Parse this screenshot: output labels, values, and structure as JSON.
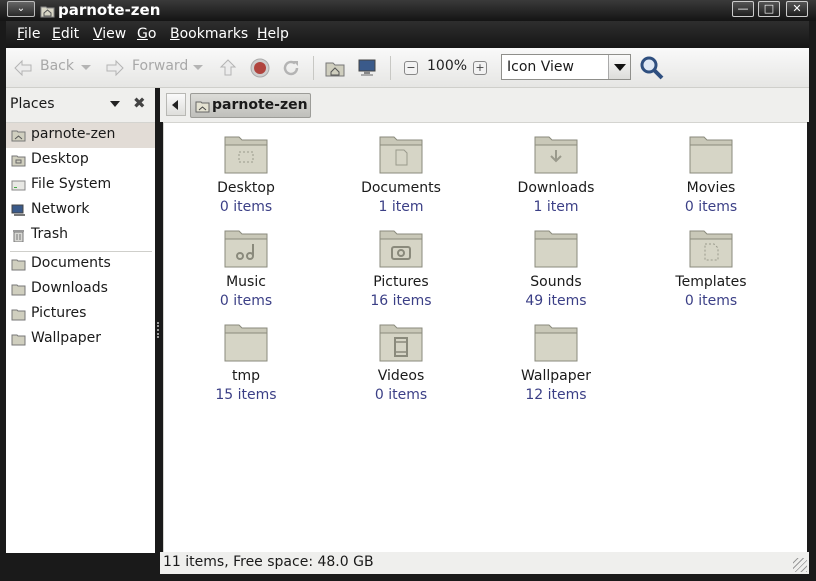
{
  "window": {
    "title": "parnote-zen",
    "controls": [
      "minimize",
      "maximize",
      "close"
    ]
  },
  "menubar": {
    "items": [
      "File",
      "Edit",
      "View",
      "Go",
      "Bookmarks",
      "Help"
    ]
  },
  "toolbar": {
    "back_label": "Back",
    "forward_label": "Forward",
    "zoom_level": "100%",
    "view_mode": "Icon View"
  },
  "sidebar": {
    "title": "Places",
    "items": [
      {
        "label": "parnote-zen",
        "icon": "home-folder-icon",
        "selected": true
      },
      {
        "label": "Desktop",
        "icon": "desktop-folder-icon"
      },
      {
        "label": "File System",
        "icon": "drive-icon"
      },
      {
        "label": "Network",
        "icon": "network-icon"
      },
      {
        "label": "Trash",
        "icon": "trash-icon"
      },
      {
        "label": "Documents",
        "icon": "folder-icon"
      },
      {
        "label": "Downloads",
        "icon": "folder-icon"
      },
      {
        "label": "Pictures",
        "icon": "folder-icon"
      },
      {
        "label": "Wallpaper",
        "icon": "folder-icon"
      }
    ]
  },
  "location": {
    "current": "parnote-zen"
  },
  "files": [
    {
      "name": "Desktop",
      "count": "0 items",
      "emblem": "desktop"
    },
    {
      "name": "Documents",
      "count": "1 item",
      "emblem": "documents"
    },
    {
      "name": "Downloads",
      "count": "1 item",
      "emblem": "downloads"
    },
    {
      "name": "Movies",
      "count": "0 items",
      "emblem": "none"
    },
    {
      "name": "Music",
      "count": "0 items",
      "emblem": "music"
    },
    {
      "name": "Pictures",
      "count": "16 items",
      "emblem": "pictures"
    },
    {
      "name": "Sounds",
      "count": "49 items",
      "emblem": "none"
    },
    {
      "name": "Templates",
      "count": "0 items",
      "emblem": "templates"
    },
    {
      "name": "tmp",
      "count": "15 items",
      "emblem": "none"
    },
    {
      "name": "Videos",
      "count": "0 items",
      "emblem": "videos"
    },
    {
      "name": "Wallpaper",
      "count": "12 items",
      "emblem": "none"
    }
  ],
  "status": {
    "text": "11 items, Free space: 48.0 GB"
  },
  "colors": {
    "item_count": "#3b3f86",
    "folder": "#c9c8b8",
    "selected_row": "#e2dcd6"
  }
}
